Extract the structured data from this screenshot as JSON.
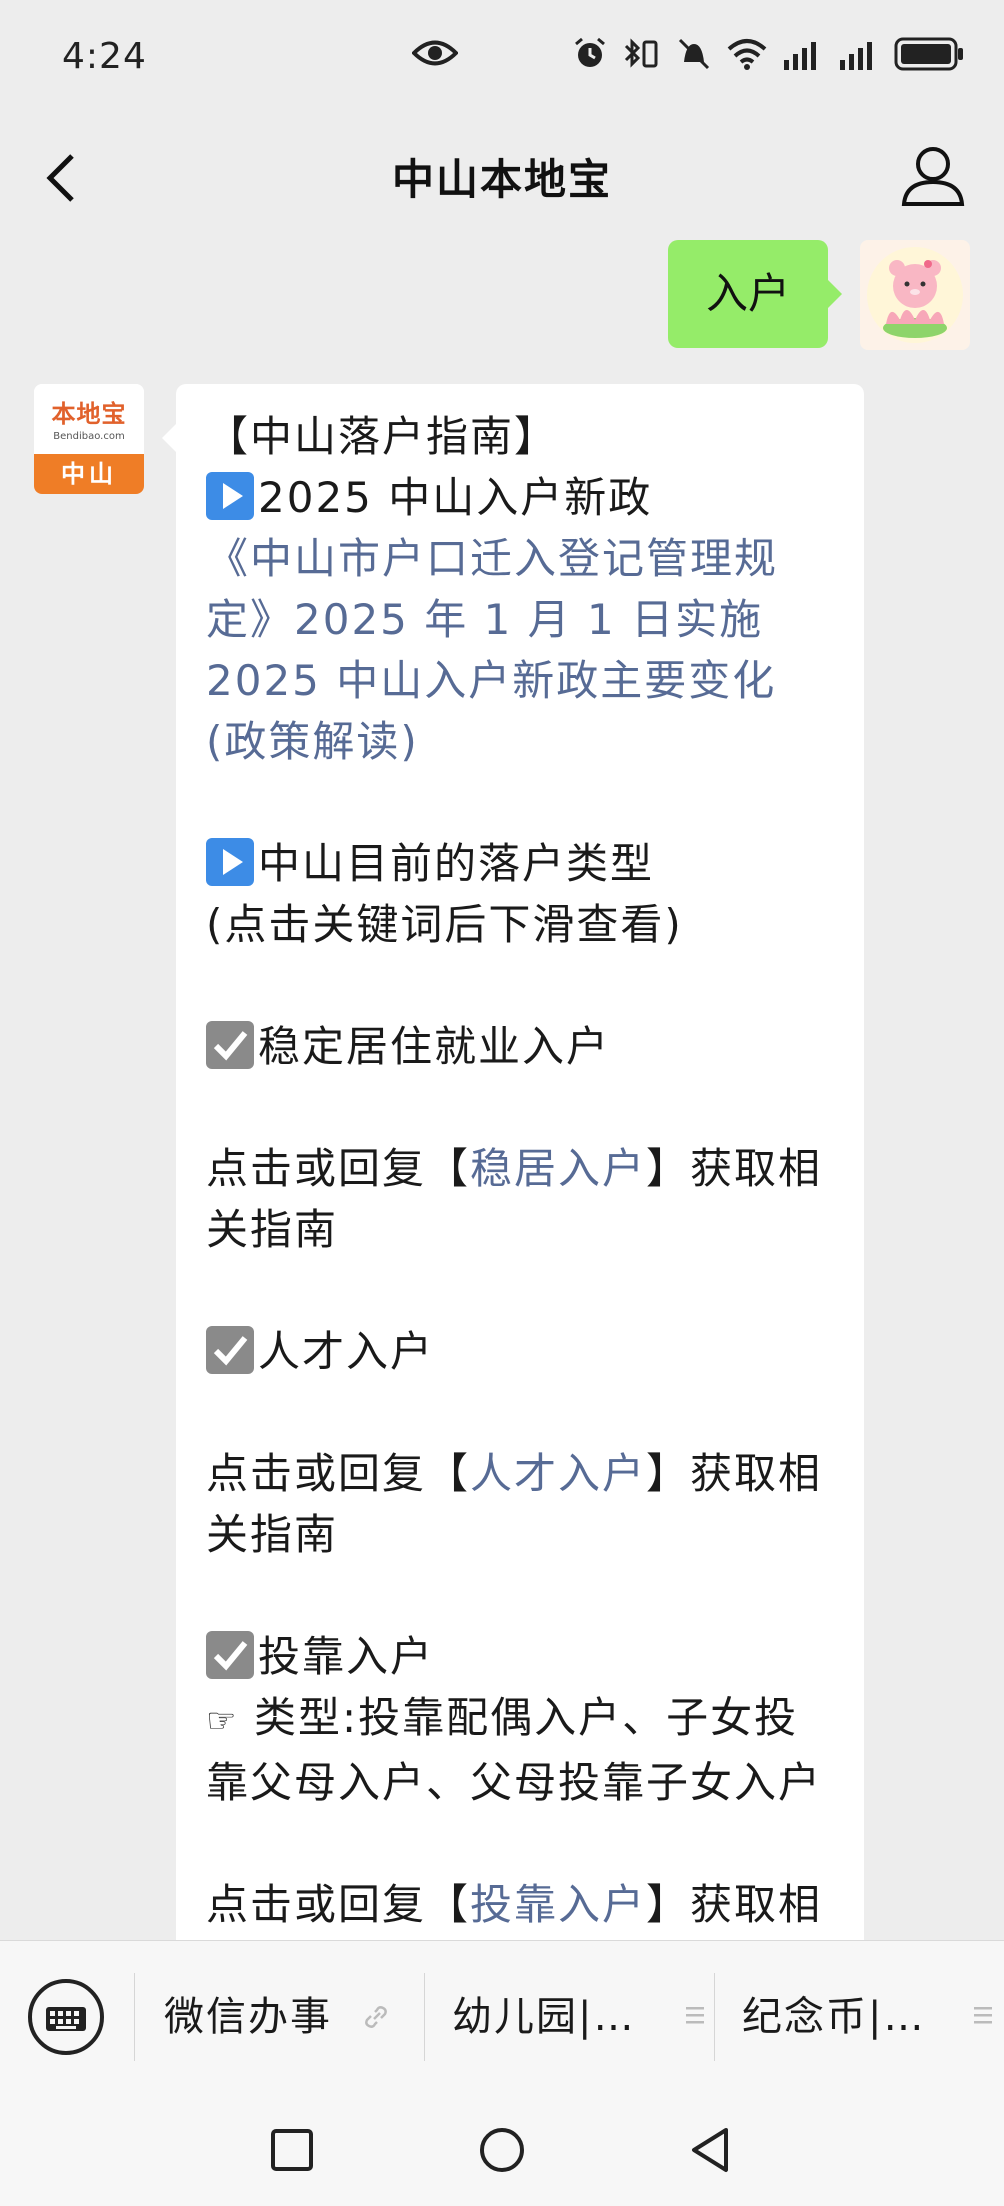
{
  "status_bar": {
    "time": "4:24",
    "icons": [
      "eye-icon",
      "alarm-icon",
      "bluetooth-vibrate-icon",
      "mute-icon",
      "wifi-icon",
      "signal-icon",
      "signal-icon",
      "battery-icon"
    ]
  },
  "navbar": {
    "title": "中山本地宝",
    "back_icon": "chevron-left-icon",
    "profile_icon": "user-icon"
  },
  "chat": {
    "sent_message": "入户",
    "bot_avatar": {
      "brand": "本地宝",
      "url": "Bendibao.com",
      "city": "中山"
    },
    "reply_lines": [
      "【中山落户指南】",
      "2025 中山入户新政",
      "《中山市户口迁入登记管理规",
      "定》2025 年 1 月 1 日实施",
      "2025 中山入户新政主要变化",
      "(政策解读)",
      "中山目前的落户类型",
      "(点击关键词后下滑查看)",
      "稳定居住就业入户",
      "点击或回复【",
      "稳居入户",
      "】获取相",
      "关指南",
      "人才入户",
      "点击或回复【",
      "人才入户",
      "】获取相",
      "关指南",
      "投靠入户",
      "类型:投靠配偶入户、子女投",
      "靠父母入户、父母投靠子女入户",
      "点击或回复【",
      "投靠入户",
      "】获取相"
    ]
  },
  "menu": {
    "items": [
      "微信办事",
      "幼儿园|…",
      "纪念币|…"
    ]
  },
  "colors": {
    "background": "#ededed",
    "sent_bubble": "#95ec69",
    "link": "#576b95",
    "brand_orange": "#ef7d26"
  }
}
